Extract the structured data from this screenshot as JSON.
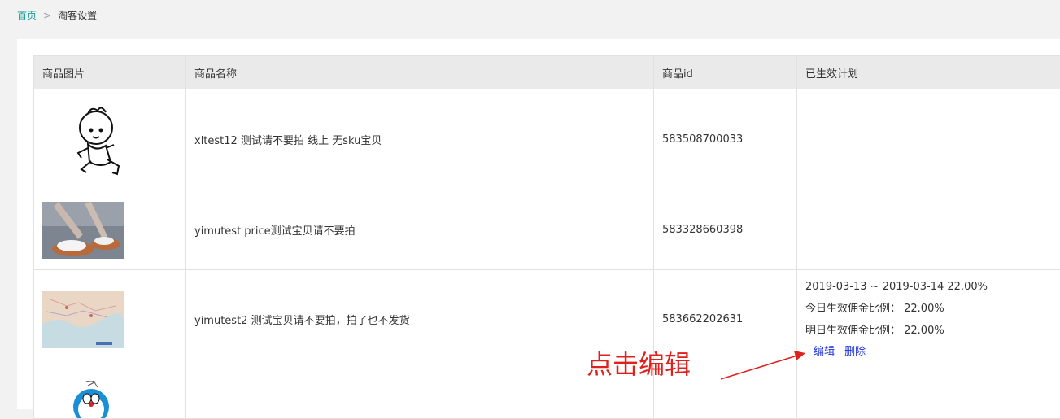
{
  "breadcrumb": {
    "home": "首页",
    "current": "淘客设置"
  },
  "table": {
    "headers": [
      "商品图片",
      "商品名称",
      "商品id",
      "已生效计划"
    ],
    "rows": [
      {
        "image": "cartoon-boy-image",
        "name": "xltest12 测试请不要拍 线上 无sku宝贝",
        "id": "583508700033"
      },
      {
        "image": "sandal-photo-image",
        "name": "yimutest price测试宝贝请不要拍",
        "id": "583328660398"
      },
      {
        "image": "map-image",
        "name": "yimutest2 测试宝贝请不要拍，拍了也不发货",
        "id": "583662202631",
        "plan": {
          "period": "2019-03-13 ~ 2019-03-14 22.00%",
          "today": "今日生效佣金比例：  22.00%",
          "tomorrow": "明日生效佣金比例：  22.00%",
          "edit_label": "编辑",
          "delete_label": "删除"
        }
      },
      {
        "image": "doraemon-image",
        "name": "",
        "id": ""
      }
    ]
  },
  "annotation": {
    "text": "点击编辑",
    "color": "#e0201c"
  },
  "colors": {
    "accent": "#1aa094",
    "link": "#1a2ee0"
  }
}
